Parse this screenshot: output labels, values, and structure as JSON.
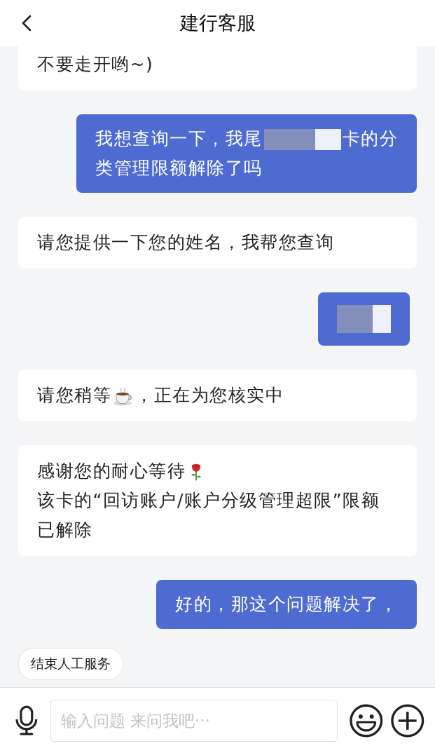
{
  "header": {
    "title": "建行客服"
  },
  "messages": [
    {
      "kind": "agent",
      "cut_top": true,
      "segments": [
        {
          "kind": "text",
          "text": "不要走开哟~)"
        }
      ]
    },
    {
      "kind": "user",
      "cut_top": false,
      "segments": [
        {
          "kind": "text",
          "text": "我想查询一下，我尾"
        },
        {
          "kind": "redacted"
        },
        {
          "kind": "text",
          "text": "卡的分"
        },
        {
          "kind": "break"
        },
        {
          "kind": "text",
          "text": "类管理限额解除了吗"
        }
      ]
    },
    {
      "kind": "agent",
      "cut_top": false,
      "segments": [
        {
          "kind": "text",
          "text": "请您提供一下您的姓名，我帮您查询"
        }
      ]
    },
    {
      "kind": "user",
      "cut_top": false,
      "segments": [
        {
          "kind": "redacted"
        }
      ]
    },
    {
      "kind": "agent",
      "cut_top": false,
      "segments": [
        {
          "kind": "text",
          "text": "请您稍等"
        },
        {
          "kind": "coffee"
        },
        {
          "kind": "text",
          "text": "，正在为您核实中"
        }
      ]
    },
    {
      "kind": "agent",
      "cut_top": false,
      "segments": [
        {
          "kind": "text",
          "text": "感谢您的耐心等待"
        },
        {
          "kind": "rose"
        },
        {
          "kind": "break"
        },
        {
          "kind": "text",
          "text": "该卡的“回访账户/账户分级管理超限”限额"
        },
        {
          "kind": "break"
        },
        {
          "kind": "text",
          "text": "已解除"
        }
      ]
    },
    {
      "kind": "user",
      "cut_top": false,
      "segments": [
        {
          "kind": "text",
          "text": "好的，那这个问题解决了，"
        }
      ]
    }
  ],
  "quick_reply": "结束人工服务",
  "input": {
    "placeholder": "输入问题 来问我吧···"
  }
}
